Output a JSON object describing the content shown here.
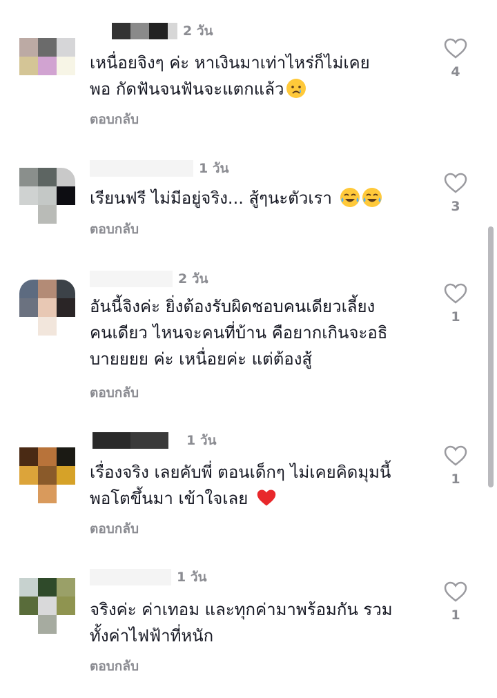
{
  "comments": [
    {
      "time": "2 วัน",
      "text": "เหนื่อยจิงๆ ค่ะ หาเงินมาเท่าไหร่ก็ไม่เคย\nพอ กัดฟันจนฟันจะแตกแล้ว",
      "emoji": "crying-face",
      "likes": "4",
      "reply": "ตอบกลับ",
      "avatar_colors": [
        "#bcaaa4",
        "#6b6b6b",
        "#d6d6d8",
        "#d4c596",
        "#d1a3d1",
        "#f7f5e6"
      ],
      "name_colors": [
        "#333333",
        "#8a8a8a",
        "#222222",
        "#d7d7d7"
      ]
    },
    {
      "time": "1 วัน",
      "text": "เรียนฟรี ไม่มีอยู่จริง... สู้ๆนะตัวเรา",
      "emoji": "tears-of-joy-face-x2",
      "likes": "3",
      "reply": "ตอบกลับ",
      "avatar_colors": [
        "#8a8f8c",
        "#5d6562",
        "#c9c9c9",
        "#cfd2d1",
        "#c4c8c6",
        "#0d0d12",
        "#ffffff",
        "#b9bbb7",
        "#ffffff"
      ],
      "name_colors": [
        "#f1f1f1",
        "#e6e6e6",
        "#f3f3f3"
      ]
    },
    {
      "time": "2 วัน",
      "text": "อันนี้จิงค่ะ ยิ่งต้องรับผิดชอบคนเดียวเลี้ยง\nคนเดียว ไหนจะคนที่บ้าน คือยากเกินจะอธิ\nบายยยย ค่ะ เหนื่อยค่ะ แต่ต้องสู้",
      "emoji": "",
      "likes": "1",
      "reply": "ตอบกลับ",
      "avatar_colors": [
        "#5d6b80",
        "#b38b76",
        "#3c4248",
        "#6b7280",
        "#e8c8b4",
        "#2a2526",
        "#ffffff",
        "#f2e6dc",
        "#ffffff"
      ],
      "name_colors": [
        "#f3f3f3",
        "#ebebeb",
        "#f5f5f5"
      ]
    },
    {
      "time": "1 วัน",
      "text": "เรื่องจริง เลยคับพี่ ตอนเด็กๆ ไม่เคยคิดมุมนี้\nพอโตขึ้นมา เข้าใจเลย",
      "emoji": "red-heart",
      "likes": "1",
      "reply": "ตอบกลับ",
      "avatar_colors": [
        "#4a2a14",
        "#b8733a",
        "#1b1a14",
        "#dca43a",
        "#8a5a2a",
        "#d6a228",
        "#ffffff",
        "#d99a5c",
        "#ffffff"
      ],
      "name_colors": [
        "#2a2a2a",
        "#3a3a3a",
        "#1f1f1f"
      ]
    },
    {
      "time": "1 วัน",
      "text": "จริงค่ะ ค่าเทอม และทุกค่ามาพร้อมกัน รวม\nทั้งค่าไฟฟ้าที่หนัก",
      "emoji": "",
      "likes": "1",
      "reply": "ตอบกลับ",
      "avatar_colors": [
        "#c7d2cf",
        "#2f4a2a",
        "#9aa068",
        "#596c3a",
        "#d9d9da",
        "#8f9450",
        "#ffffff",
        "#a6aba0",
        "#ffffff"
      ],
      "name_colors": [
        "#f2f2f2",
        "#e8e8e8",
        "#f4f4f4"
      ]
    }
  ]
}
